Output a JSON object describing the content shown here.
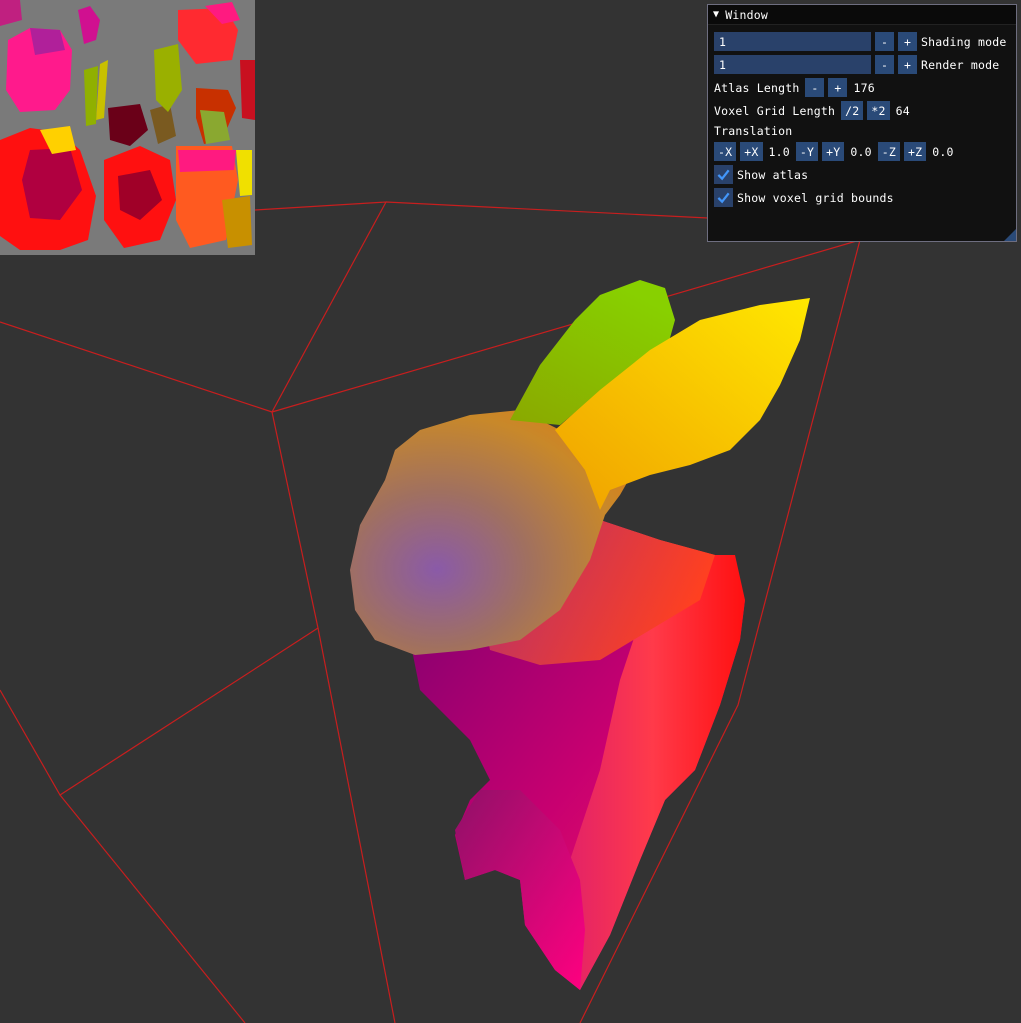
{
  "window": {
    "title": "Window",
    "shading_mode": {
      "value": "1",
      "label": "Shading mode",
      "dec": "-",
      "inc": "+"
    },
    "render_mode": {
      "value": "1",
      "label": "Render mode",
      "dec": "-",
      "inc": "+"
    },
    "atlas_length": {
      "label": "Atlas Length",
      "dec": "-",
      "inc": "+",
      "value": "176"
    },
    "voxel_grid_length": {
      "label": "Voxel Grid Length",
      "halve": "/2",
      "double": "*2",
      "value": "64"
    },
    "translation": {
      "label": "Translation",
      "neg_x": "-X",
      "pos_x": "+X",
      "x": "1.0",
      "neg_y": "-Y",
      "pos_y": "+Y",
      "y": "0.0",
      "neg_z": "-Z",
      "pos_z": "+Z",
      "z": "0.0"
    },
    "show_atlas": {
      "label": "Show atlas",
      "checked": true
    },
    "show_voxel_grid_bounds": {
      "label": "Show voxel grid bounds",
      "checked": true
    }
  },
  "colors": {
    "background": "#333333",
    "bounds_line": "#c81e1e",
    "widget_bg": "#29416a",
    "button_bg": "#2a4a78",
    "checkmark": "#4296fa"
  }
}
